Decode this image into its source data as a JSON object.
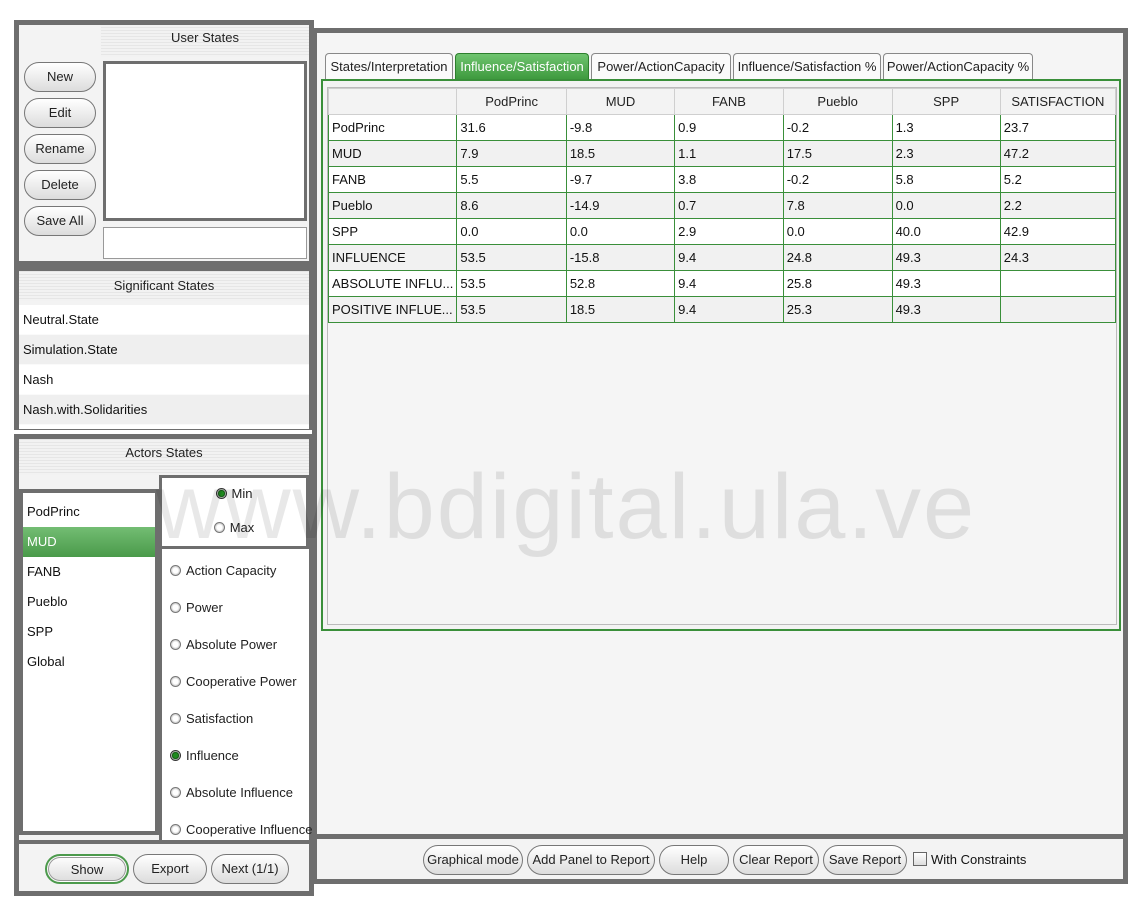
{
  "left_buttons": [
    "New",
    "Edit",
    "Rename",
    "Delete",
    "Save All"
  ],
  "user_states": {
    "header": "User States",
    "name_input_value": ""
  },
  "significant_states": {
    "header": "Significant States",
    "items": [
      "Neutral.State",
      "Simulation.State",
      "Nash",
      "Nash.with.Solidarities"
    ]
  },
  "actors_states": {
    "header": "Actors States",
    "actors": [
      "PodPrinc",
      "MUD",
      "FANB",
      "Pueblo",
      "SPP",
      "Global"
    ],
    "selected_actor": "MUD",
    "min_label": "Min",
    "max_label": "Max",
    "minmax_selected": "Min",
    "metrics": [
      "Action Capacity",
      "Power",
      "Absolute Power",
      "Cooperative Power",
      "Satisfaction",
      "Influence",
      "Absolute Influence",
      "Cooperative Influence"
    ],
    "selected_metric": "Influence"
  },
  "bottom_left_buttons": [
    "Show",
    "Export",
    "Next (1/1)"
  ],
  "tabs": [
    "States/Interpretation",
    "Influence/Satisfaction",
    "Power/ActionCapacity",
    "Influence/Satisfaction %",
    "Power/ActionCapacity %"
  ],
  "active_tab": "Influence/Satisfaction",
  "table": {
    "columns": [
      "",
      "PodPrinc",
      "MUD",
      "FANB",
      "Pueblo",
      "SPP",
      "SATISFACTION"
    ],
    "rows": [
      [
        "PodPrinc",
        "31.6",
        "-9.8",
        "0.9",
        "-0.2",
        "1.3",
        "23.7"
      ],
      [
        "MUD",
        "7.9",
        "18.5",
        "1.1",
        "17.5",
        "2.3",
        "47.2"
      ],
      [
        "FANB",
        "5.5",
        "-9.7",
        "3.8",
        "-0.2",
        "5.8",
        "5.2"
      ],
      [
        "Pueblo",
        "8.6",
        "-14.9",
        "0.7",
        "7.8",
        "0.0",
        "2.2"
      ],
      [
        "SPP",
        "0.0",
        "0.0",
        "2.9",
        "0.0",
        "40.0",
        "42.9"
      ],
      [
        "INFLUENCE",
        "53.5",
        "-15.8",
        "9.4",
        "24.8",
        "49.3",
        "24.3"
      ],
      [
        "ABSOLUTE INFLU...",
        "53.5",
        "52.8",
        "9.4",
        "25.8",
        "49.3",
        ""
      ],
      [
        "POSITIVE INFLUE...",
        "53.5",
        "18.5",
        "9.4",
        "25.3",
        "49.3",
        ""
      ]
    ]
  },
  "bottom_right_buttons": [
    "Graphical mode",
    "Add Panel to Report",
    "Help",
    "Clear Report",
    "Save Report"
  ],
  "with_constraints": {
    "label": "With Constraints",
    "checked": false
  },
  "watermark": "www.bdigital.ula.ve",
  "colors": {
    "accent_green": "#4a9a4a",
    "frame_gray": "#6e6e6e",
    "grid_green": "#3a8f3a"
  }
}
